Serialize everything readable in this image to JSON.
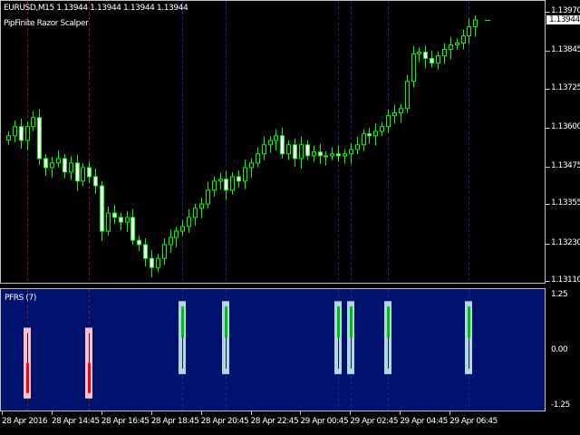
{
  "header": {
    "symbol_line": "EURUSD,M15  1.13944 1.13944 1.13944 1.13944",
    "indicator_name": "PipFinite Razor Scalper"
  },
  "indicator": {
    "label": "PFRS (7)",
    "axis": [
      "1.25",
      "0.00",
      "-1.25"
    ]
  },
  "price_axis": {
    "labels": [
      "1.13970",
      "1.13845",
      "1.13725",
      "1.13600",
      "1.13475",
      "1.13355",
      "1.13230",
      "1.13110"
    ],
    "current": "1.13944"
  },
  "time_axis": [
    "28 Apr 2016",
    "28 Apr 14:45",
    "28 Apr 16:45",
    "28 Apr 18:45",
    "28 Apr 20:45",
    "28 Apr 22:45",
    "29 Apr 00:45",
    "29 Apr 02:45",
    "29 Apr 04:45",
    "29 Apr 06:45"
  ],
  "colors": {
    "bull": "#00ff00",
    "bear": "#ffffff",
    "panel": "#00126e",
    "sell": "#ff0000",
    "buy": "#00c000",
    "sell_box": "#ffc0cb",
    "buy_box": "#add8e6"
  },
  "chart_data": {
    "type": "candlestick",
    "timeframe": "M15",
    "first_open": 1.1356,
    "closes": [
      1.13574,
      1.13603,
      1.13559,
      1.13603,
      1.13632,
      1.13501,
      1.13472,
      1.13487,
      1.13501,
      1.13458,
      1.13487,
      1.13429,
      1.13472,
      1.13443,
      1.13414,
      1.13269,
      1.13327,
      1.13313,
      1.13298,
      1.13313,
      1.1324,
      1.13226,
      1.13182,
      1.13153,
      1.13182,
      1.13226,
      1.13249,
      1.13269,
      1.13284,
      1.13313,
      1.13342,
      1.13356,
      1.134,
      1.13429,
      1.13435,
      1.134,
      1.13443,
      1.13429,
      1.13472,
      1.13487,
      1.13516,
      1.13545,
      1.13559,
      1.13574,
      1.13516,
      1.13545,
      1.13501,
      1.13545,
      1.1351,
      1.13522,
      1.1351,
      1.1351,
      1.13516,
      1.1351,
      1.13516,
      1.1353,
      1.13545,
      1.1358,
      1.13574,
      1.13588,
      1.13603,
      1.13638,
      1.13647,
      1.13661,
      1.13748,
      1.13835,
      1.13841,
      1.13821,
      1.13806,
      1.13829,
      1.1385,
      1.13864,
      1.1387,
      1.13893,
      1.13922,
      1.13944
    ],
    "ylim": [
      1.131,
      1.13985
    ],
    "signals": [
      {
        "i": 3,
        "type": "sell"
      },
      {
        "i": 13,
        "type": "sell"
      },
      {
        "i": 28,
        "type": "buy"
      },
      {
        "i": 35,
        "type": "buy"
      },
      {
        "i": 53,
        "type": "buy"
      },
      {
        "i": 55,
        "type": "buy"
      },
      {
        "i": 61,
        "type": "buy"
      },
      {
        "i": 74,
        "type": "buy"
      }
    ],
    "indicator_range": [
      -1.25,
      1.25
    ]
  }
}
